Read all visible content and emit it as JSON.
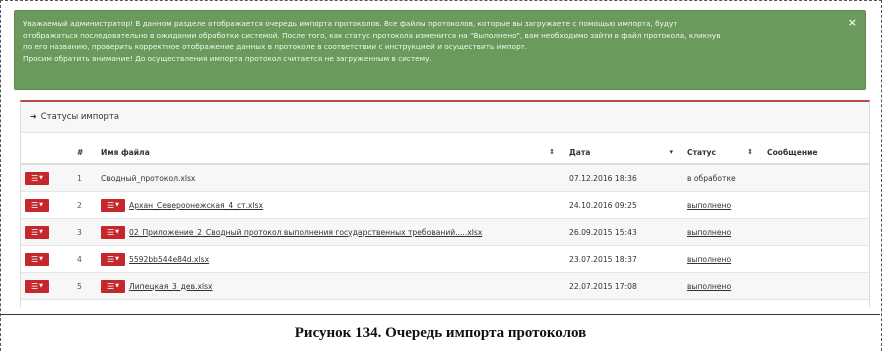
{
  "alert": {
    "lines": [
      "Уважаемый администратор! В данном разделе отображается очередь импорта протоколов. Все файлы протоколов, которые вы загружаете с помощью импорта, будут",
      "отображаться последовательно в ожидании обработки системой. После того, как статус протокола изменится на \"Выполнено\", вам необходимо зайти в файл протокола, кликнув",
      "по его названию, проверить корректное отображение данных в протоколе в соответствии с инструкцией и осуществить импорт.",
      "Просим обратить внимание! До осуществления импорта протокол считается не загруженным в систему."
    ],
    "close_label": "×"
  },
  "panel": {
    "title": "Статусы импорта",
    "heading_icon": "sign-in-icon"
  },
  "table": {
    "headers": {
      "num": "#",
      "file": "Имя файла",
      "date": "Дата",
      "status": "Статус",
      "message": "Сообщение"
    },
    "rows": [
      {
        "num": "1",
        "file": "Сводный_протокол.xlsx",
        "date": "07.12.2016 18:36",
        "status": "в обработке",
        "message": ""
      },
      {
        "num": "2",
        "file": "Архан_Североонежская_4_ст.xlsx",
        "date": "24.10.2016 09:25",
        "status": "выполнено",
        "message": ""
      },
      {
        "num": "3",
        "file": "02_Приложение_2_Сводный протокол выполнения государственных требований.....xlsx",
        "date": "26.09.2015 15:43",
        "status": "выполнено",
        "message": ""
      },
      {
        "num": "4",
        "file": "5592bb544e84d.xlsx",
        "date": "23.07.2015 18:37",
        "status": "выполнено",
        "message": ""
      },
      {
        "num": "5",
        "file": "Липецкая_3_дев.xlsx",
        "date": "22.07.2015 17:08",
        "status": "выполнено",
        "message": ""
      }
    ]
  },
  "caption": "Рисунок 134. Очередь импорта протоколов",
  "colors": {
    "alert_bg": "#6a9a5c",
    "panel_accent": "#b84a48",
    "menu_button": "#c4282c"
  }
}
